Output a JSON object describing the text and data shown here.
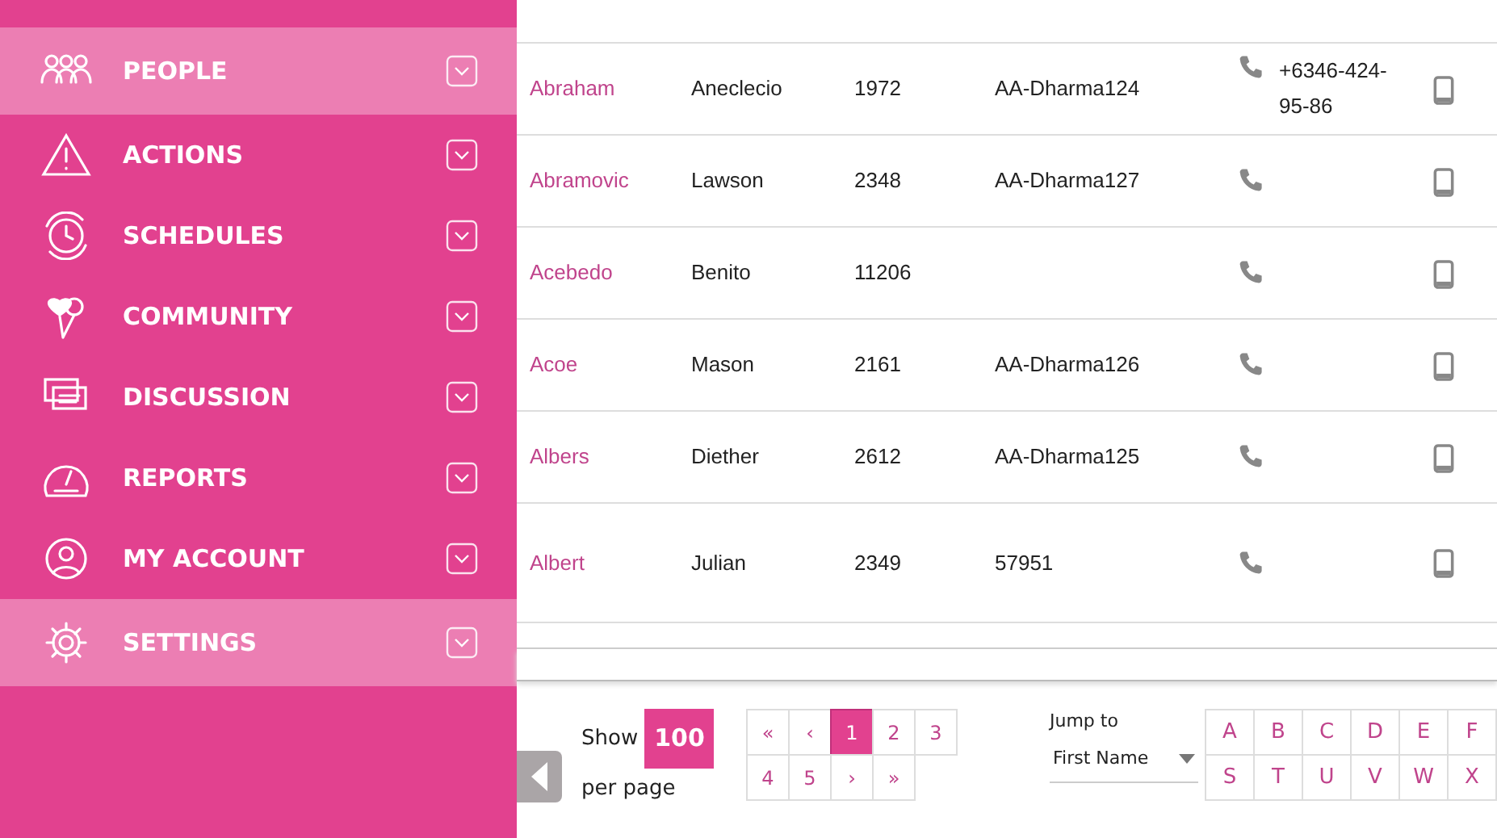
{
  "sidebar": {
    "items": [
      {
        "label": "PEOPLE",
        "selected": true
      },
      {
        "label": "ACTIONS",
        "selected": false
      },
      {
        "label": "SCHEDULES",
        "selected": false
      },
      {
        "label": "COMMUNITY",
        "selected": false
      },
      {
        "label": "DISCUSSION",
        "selected": false
      },
      {
        "label": "REPORTS",
        "selected": false
      },
      {
        "label": "MY ACCOUNT",
        "selected": false
      },
      {
        "label": "SETTINGS",
        "selected": true
      }
    ]
  },
  "table": {
    "rows": [
      {
        "last_name": "Abraham",
        "first_name": "Aneclecio",
        "number": "1972",
        "code": "AA-Dharma124",
        "phone": "+6346-424-95-86"
      },
      {
        "last_name": "Abramovic",
        "first_name": "Lawson",
        "number": "2348",
        "code": "AA-Dharma127",
        "phone": ""
      },
      {
        "last_name": "Acebedo",
        "first_name": "Benito",
        "number": "11206",
        "code": "",
        "phone": ""
      },
      {
        "last_name": "Acoe",
        "first_name": "Mason",
        "number": "2161",
        "code": "AA-Dharma126",
        "phone": ""
      },
      {
        "last_name": "Albers",
        "first_name": "Diether",
        "number": "2612",
        "code": "AA-Dharma125",
        "phone": ""
      },
      {
        "last_name": "Albert",
        "first_name": "Julian",
        "number": "2349",
        "code": "57951",
        "phone": ""
      }
    ]
  },
  "footer": {
    "show_label": "Show",
    "per_page_value": "100",
    "per_page_label": "per page",
    "pages": [
      {
        "label": "«",
        "selected": false
      },
      {
        "label": "‹",
        "selected": false
      },
      {
        "label": "1",
        "selected": true
      },
      {
        "label": "2",
        "selected": false
      },
      {
        "label": "3",
        "selected": false
      },
      {
        "label": "4",
        "selected": false
      },
      {
        "label": "5",
        "selected": false
      },
      {
        "label": "›",
        "selected": false
      },
      {
        "label": "»",
        "selected": false
      }
    ],
    "jump_label": "Jump to",
    "jump_value": "First Name",
    "letters": [
      "A",
      "B",
      "C",
      "D",
      "E",
      "F",
      "S",
      "T",
      "U",
      "V",
      "W",
      "X"
    ]
  }
}
